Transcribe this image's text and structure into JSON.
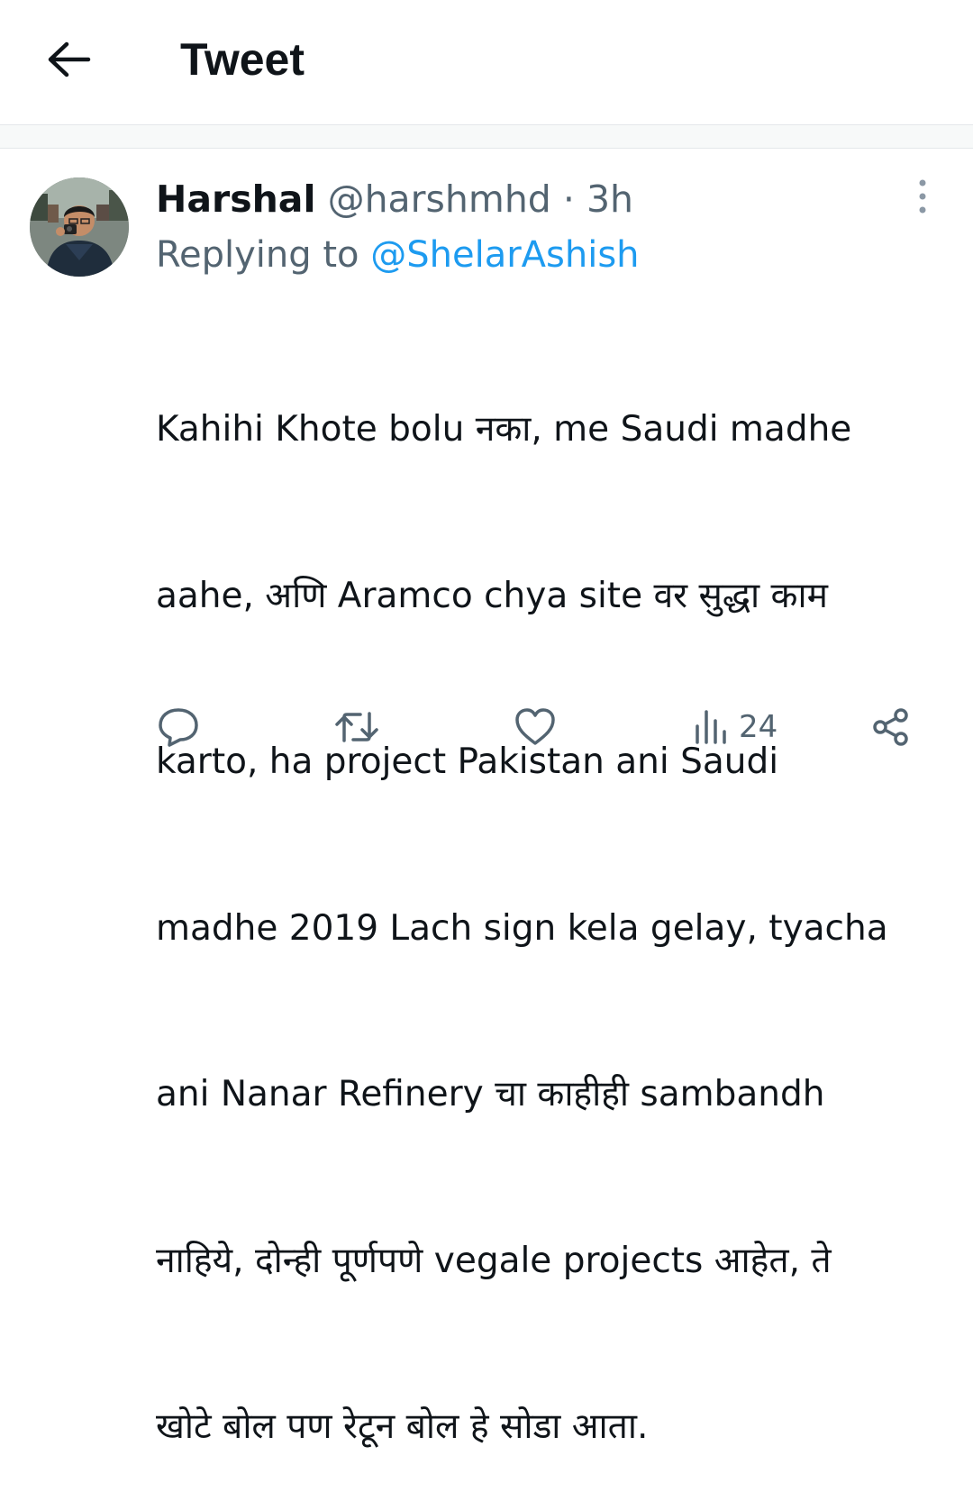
{
  "header": {
    "title": "Tweet",
    "back_icon": "arrow-left-icon"
  },
  "tweet": {
    "author_name": "Harshal",
    "author_handle": "@harshmhd",
    "separator": "·",
    "time": "3h",
    "reply_prefix": "Replying to",
    "reply_to": "@ShelarAshish",
    "text_lines": [
      "Kahihi Khote bolu नका,  me Saudi madhe",
      "aahe, अणि Aramco chya site वर सुद्धा काम",
      "karto, ha project Pakistan ani Saudi",
      "madhe 2019 Lach sign kela gelay, tyacha",
      "ani Nanar Refinery चा काहीही sambandh",
      "नाहिये, दोन्ही पूर्णपणे vegale projects आहेत, ते",
      "खोटे बोल पण रेटून बोल हे सोडा आता."
    ]
  },
  "actions": {
    "reply_icon": "reply-bubble-icon",
    "retweet_icon": "retweet-icon",
    "like_icon": "heart-icon",
    "views_icon": "views-bars-icon",
    "views_count": "24",
    "share_icon": "share-icon"
  },
  "colors": {
    "text": "#0f1419",
    "secondary": "#536471",
    "link": "#1d9bf0",
    "divider": "#e4e7ea",
    "gap": "#f7f9f9"
  }
}
